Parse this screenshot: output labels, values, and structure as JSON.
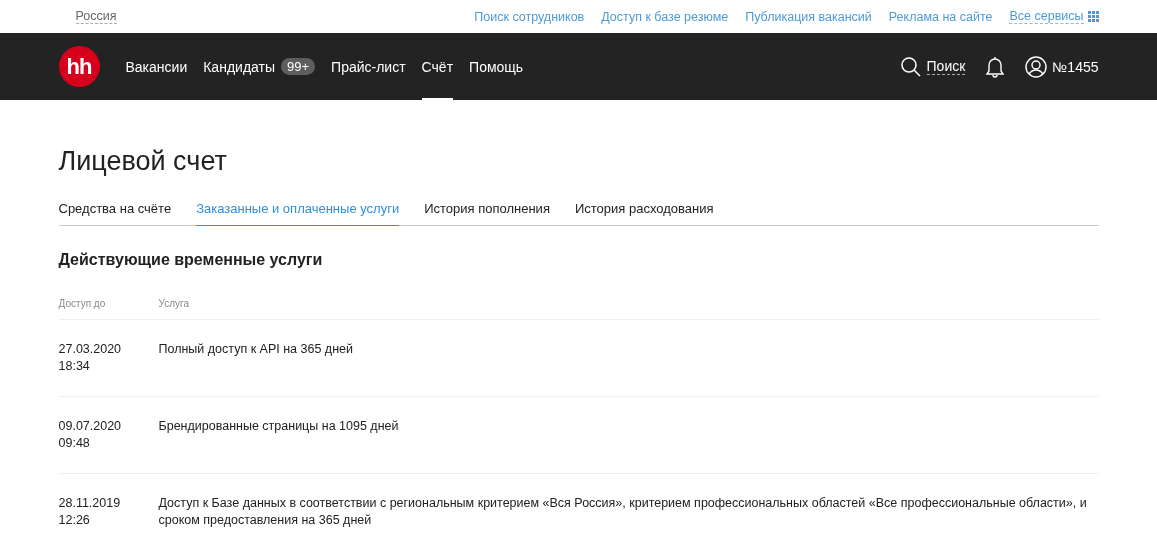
{
  "top_bar": {
    "region": "Россия",
    "links": [
      "Поиск сотрудников",
      "Доступ к базе резюме",
      "Публикация вакансий",
      "Реклама на сайте"
    ],
    "all_services": "Все сервисы"
  },
  "nav": {
    "logo": "hh",
    "items": [
      {
        "label": "Вакансии",
        "selected": false
      },
      {
        "label": "Кандидаты",
        "badge": "99+",
        "selected": false
      },
      {
        "label": "Прайс-лист",
        "selected": false
      },
      {
        "label": "Счёт",
        "selected": true
      },
      {
        "label": "Помощь",
        "selected": false
      }
    ],
    "search": "Поиск",
    "account": "№1455"
  },
  "page": {
    "title": "Лицевой счет",
    "tabs": [
      {
        "label": "Средства на счёте",
        "selected": false
      },
      {
        "label": "Заказанные и оплаченные услуги",
        "selected": true
      },
      {
        "label": "История пополнения",
        "selected": false
      },
      {
        "label": "История расходования",
        "selected": false
      }
    ],
    "section_title": "Действующие временные услуги",
    "table": {
      "columns": [
        "Доступ до",
        "Услуга"
      ],
      "rows": [
        {
          "date": "27.03.2020",
          "time": "18:34",
          "service": "Полный доступ к API на 365 дней"
        },
        {
          "date": "09.07.2020",
          "time": "09:48",
          "service": "Брендированные страницы на 1095 дней"
        },
        {
          "date": "28.11.2019",
          "time": "12:26",
          "service": "Доступ к Базе данных в соответствии с региональным критерием «Вся Россия», критерием профессиональных областей «Все профессиональные области», и сроком предоставления на 365 дней"
        }
      ]
    }
  }
}
